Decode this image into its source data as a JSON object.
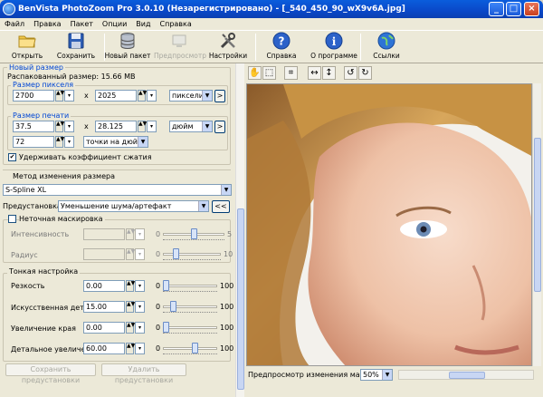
{
  "window": {
    "title": "BenVista PhotoZoom Pro 3.0.10 (Незарегистрировано) - [_540_450_90_wX9v6A.jpg]",
    "minimize": "_",
    "maximize": "□",
    "close": "×"
  },
  "menu": [
    "Файл",
    "Правка",
    "Пакет",
    "Опции",
    "Вид",
    "Справка"
  ],
  "toolbar": {
    "open": "Открыть",
    "save": "Сохранить",
    "batch": "Новый пакет",
    "preview": "Предпросмотр",
    "settings": "Настройки",
    "help": "Справка",
    "about": "О программе",
    "links": "Ссылки"
  },
  "left": {
    "newsize_title": "Новый размер",
    "unpacked": "Распакованный размер: 15.66 MB",
    "pixel_group": "Размер пикселя",
    "px_width": "2700",
    "px_height": "2025",
    "x_sign": "x",
    "px_unit": "пиксели",
    "print_group": "Размер печати",
    "print_width": "37.5",
    "print_height": "28.125",
    "print_unit": "дюйм",
    "resolution": "72",
    "res_unit": "точки на дюйм",
    "keep_ratio": "Удерживать коэффициент сжатия",
    "go_btn": ">",
    "method_title": "Метод изменения размера",
    "method_value": "S-Spline XL",
    "preset_label": "Предустановка:",
    "preset_value": "Уменьшение шума/артефакт",
    "preset_btn": "<<",
    "unsharp_label": "Неточная маскировка",
    "intensity_label": "Интенсивность",
    "intensity_min": "0",
    "intensity_max": "5",
    "radius_label": "Радиус",
    "radius_min": "0",
    "radius_max": "10",
    "fine_title": "Тонкая настройка",
    "sharpness_label": "Резкость",
    "sharpness_value": "0.00",
    "artificial_label": "Искусственная деталь",
    "artificial_value": "15.00",
    "edge_label": "Увеличение края",
    "edge_value": "0.00",
    "detail_label": "Детальное увеличение",
    "detail_value": "60.00",
    "min0": "0",
    "max100": "100",
    "save_preset": "Сохранить предустановки",
    "delete_preset": "Удалить предустановки"
  },
  "status": {
    "zoom_label": "Предпросмотр изменения масштаба:",
    "zoom_value": "50%"
  },
  "slider_levels": {
    "intensity": 0.5,
    "radius": 0.2,
    "sharpness": 0.0,
    "artificial": 0.15,
    "edge": 0.0,
    "detail": 0.6
  }
}
